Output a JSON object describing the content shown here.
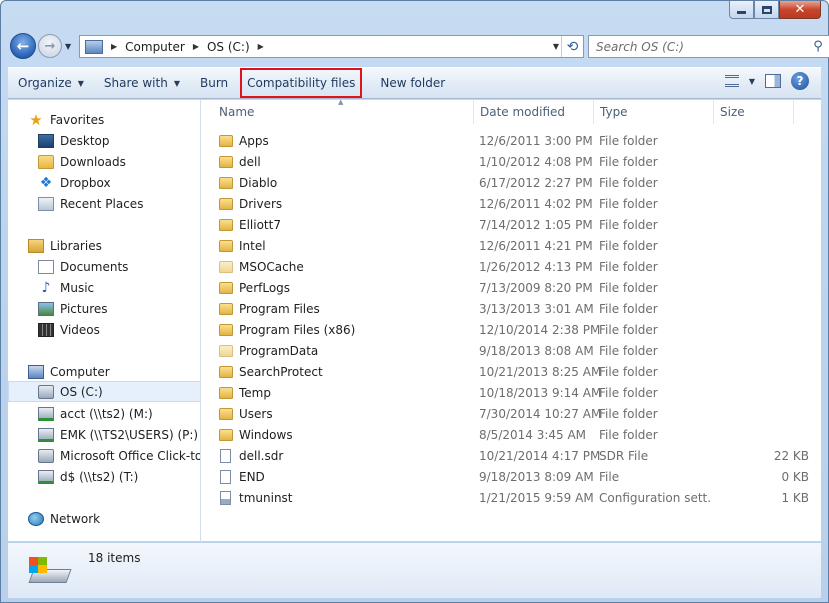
{
  "window": {
    "caption_buttons": [
      "minimize",
      "maximize",
      "close"
    ]
  },
  "address": {
    "crumbs": [
      "Computer",
      "OS (C:)"
    ],
    "search_placeholder": "Search OS (C:)"
  },
  "toolbar": {
    "organize": "Organize",
    "share_with": "Share with",
    "burn": "Burn",
    "compatibility_files": "Compatibility files",
    "new_folder": "New folder",
    "highlight_color": "#e0121b"
  },
  "nav": {
    "favorites": "Favorites",
    "desktop": "Desktop",
    "downloads": "Downloads",
    "dropbox": "Dropbox",
    "recent_places": "Recent Places",
    "libraries": "Libraries",
    "documents": "Documents",
    "music": "Music",
    "pictures": "Pictures",
    "videos": "Videos",
    "computer": "Computer",
    "os_c": "OS (C:)",
    "acct": "acct (\\\\ts2) (M:)",
    "emk": "EMK (\\\\TS2\\USERS) (P:)",
    "office": "Microsoft Office Click-to-R",
    "dollar": "d$ (\\\\ts2) (T:)",
    "network": "Network"
  },
  "columns": {
    "name": "Name",
    "date": "Date modified",
    "type": "Type",
    "size": "Size"
  },
  "files": [
    {
      "name": "Apps",
      "date": "12/6/2011 3:00 PM",
      "type": "File folder",
      "size": "",
      "icon": "folder"
    },
    {
      "name": "dell",
      "date": "1/10/2012 4:08 PM",
      "type": "File folder",
      "size": "",
      "icon": "folder"
    },
    {
      "name": "Diablo",
      "date": "6/17/2012 2:27 PM",
      "type": "File folder",
      "size": "",
      "icon": "folder"
    },
    {
      "name": "Drivers",
      "date": "12/6/2011 4:02 PM",
      "type": "File folder",
      "size": "",
      "icon": "folder"
    },
    {
      "name": "Elliott7",
      "date": "7/14/2012 1:05 PM",
      "type": "File folder",
      "size": "",
      "icon": "folder"
    },
    {
      "name": "Intel",
      "date": "12/6/2011 4:21 PM",
      "type": "File folder",
      "size": "",
      "icon": "folder"
    },
    {
      "name": "MSOCache",
      "date": "1/26/2012 4:13 PM",
      "type": "File folder",
      "size": "",
      "icon": "folder-hidden"
    },
    {
      "name": "PerfLogs",
      "date": "7/13/2009 8:20 PM",
      "type": "File folder",
      "size": "",
      "icon": "folder"
    },
    {
      "name": "Program Files",
      "date": "3/13/2013 3:01 AM",
      "type": "File folder",
      "size": "",
      "icon": "folder"
    },
    {
      "name": "Program Files (x86)",
      "date": "12/10/2014 2:38 PM",
      "type": "File folder",
      "size": "",
      "icon": "folder"
    },
    {
      "name": "ProgramData",
      "date": "9/18/2013 8:08 AM",
      "type": "File folder",
      "size": "",
      "icon": "folder-hidden"
    },
    {
      "name": "SearchProtect",
      "date": "10/21/2013 8:25 AM",
      "type": "File folder",
      "size": "",
      "icon": "folder"
    },
    {
      "name": "Temp",
      "date": "10/18/2013 9:14 AM",
      "type": "File folder",
      "size": "",
      "icon": "folder"
    },
    {
      "name": "Users",
      "date": "7/30/2014 10:27 AM",
      "type": "File folder",
      "size": "",
      "icon": "folder"
    },
    {
      "name": "Windows",
      "date": "8/5/2014 3:45 AM",
      "type": "File folder",
      "size": "",
      "icon": "folder"
    },
    {
      "name": "dell.sdr",
      "date": "10/21/2014 4:17 PM",
      "type": "SDR File",
      "size": "22 KB",
      "icon": "file"
    },
    {
      "name": "END",
      "date": "9/18/2013 8:09 AM",
      "type": "File",
      "size": "0 KB",
      "icon": "file"
    },
    {
      "name": "tmuninst",
      "date": "1/21/2015 9:59 AM",
      "type": "Configuration sett...",
      "size": "1 KB",
      "icon": "config-file"
    }
  ],
  "status": {
    "count": "18 items"
  }
}
